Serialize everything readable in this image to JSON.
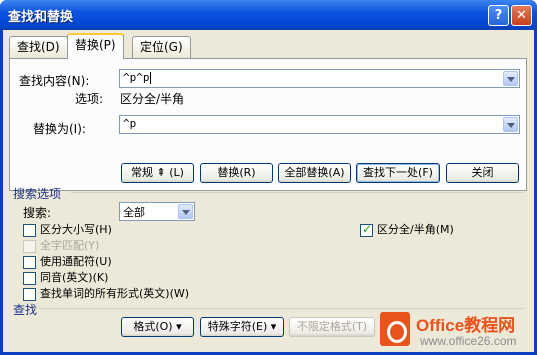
{
  "window": {
    "title": "查找和替换",
    "help_glyph": "?",
    "close_glyph": "✕"
  },
  "tabs": [
    {
      "label": "查找(D)"
    },
    {
      "label": "替换(P)"
    },
    {
      "label": "定位(G)"
    }
  ],
  "find": {
    "label": "查找内容(N):",
    "value": "^p^p",
    "options_label": "选项:",
    "options_value": "区分全/半角"
  },
  "replace": {
    "label": "替换为(I):",
    "value": "^p"
  },
  "buttons": {
    "normal": "常规 ⇞ (L)",
    "replace": "替换(R)",
    "replace_all": "全部替换(A)",
    "find_next": "查找下一处(F)",
    "close": "关闭"
  },
  "search_options": {
    "section_label": "搜索选项",
    "search_label": "搜索:",
    "search_value": "全部",
    "checkboxes": [
      {
        "label": "区分大小写(H)",
        "checked": false,
        "disabled": false
      },
      {
        "label": "全字匹配(Y)",
        "checked": false,
        "disabled": true
      },
      {
        "label": "使用通配符(U)",
        "checked": false,
        "disabled": false
      },
      {
        "label": "同音(英文)(K)",
        "checked": false,
        "disabled": false
      },
      {
        "label": "查找单词的所有形式(英文)(W)",
        "checked": false,
        "disabled": false
      }
    ],
    "right_checkbox": {
      "label": "区分全/半角(M)",
      "checked": true
    }
  },
  "find_section": {
    "label": "查找",
    "format_button": "格式(O) ▾",
    "special_button": "特殊字符(E) ▾",
    "no_format_button": "不限定格式(T)"
  },
  "watermark": {
    "brand": "Office教程网",
    "url": "www.office26.com"
  },
  "colors": {
    "title_bar": "#0d53e0",
    "dialog_bg": "#ece9d8",
    "logo": "#e8541c"
  }
}
